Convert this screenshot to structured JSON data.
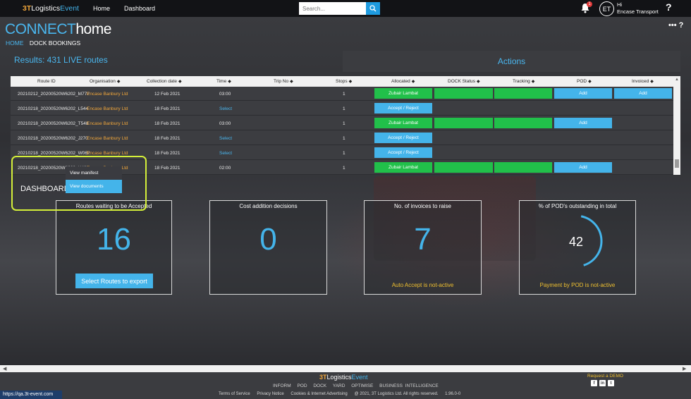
{
  "topbar": {
    "logo": {
      "prefix": "3T",
      "name": "Logistics",
      "suffix": "Event"
    },
    "nav": [
      "Home",
      "Dashboard"
    ],
    "search_placeholder": "Search...",
    "notification_count": "1",
    "avatar_initials": "ET",
    "user_greeting": "Hi",
    "user_name": "Encase Transport",
    "help": "?"
  },
  "page": {
    "brand_connect": "CONNECT",
    "brand_home": "home",
    "breadcrumb_home": "HOME",
    "breadcrumb_current": "DOCK BOOKINGS",
    "corner": "•••",
    "corner_help": "?",
    "results": "Results: 431 LIVE routes",
    "actions": "Actions"
  },
  "table": {
    "columns": [
      "Route ID",
      "Organisation",
      "Collection date",
      "Time",
      "Trip No",
      "Stops",
      "Allocated",
      "DOCK Status",
      "Tracking",
      "POD",
      "Invoiced"
    ],
    "rows": [
      {
        "route": "20210212_20200520W6202_M772",
        "org": "Encase Banbury Ltd",
        "date": "12 Feb 2021",
        "time": "03:00",
        "time_link": false,
        "stops": "1",
        "allocated": "Zubair Lambat",
        "assigned": true,
        "pod": "Add",
        "invoiced": "Add"
      },
      {
        "route": "20210218_20200520W6202_L544",
        "org": "Encase Banbury Ltd",
        "date": "18 Feb 2021",
        "time": "Select",
        "time_link": true,
        "stops": "1",
        "allocated": "Accept / Reject",
        "assigned": false,
        "pod": "",
        "invoiced": ""
      },
      {
        "route": "20210218_20200520W6202_T548",
        "org": "Encase Banbury Ltd",
        "date": "18 Feb 2021",
        "time": "03:00",
        "time_link": false,
        "stops": "1",
        "allocated": "Zubair Lambat",
        "assigned": true,
        "pod": "Add",
        "invoiced": ""
      },
      {
        "route": "20210218_20200520W6202_J270",
        "org": "Encase Banbury Ltd",
        "date": "18 Feb 2021",
        "time": "Select",
        "time_link": true,
        "stops": "1",
        "allocated": "Accept / Reject",
        "assigned": false,
        "pod": "",
        "invoiced": ""
      },
      {
        "route": "20210218_20200520W6202_W062",
        "org": "Encase Banbury Ltd",
        "date": "18 Feb 2021",
        "time": "Select",
        "time_link": true,
        "stops": "1",
        "allocated": "Accept / Reject",
        "assigned": false,
        "pod": "",
        "invoiced": ""
      },
      {
        "route": "20210218_20200520W6202_H485",
        "org": "Encase Banbury Ltd",
        "date": "18 Feb 2021",
        "time": "02:00",
        "time_link": false,
        "stops": "1",
        "allocated": "Zubair Lambat",
        "assigned": true,
        "pod": "Add",
        "invoiced": ""
      }
    ]
  },
  "context_menu": {
    "items": [
      "View manifest",
      "View documents"
    ],
    "active_index": 1
  },
  "dashboard": {
    "label": "DASHBOARD",
    "cards": [
      {
        "title": "Routes waiting to be Accepted",
        "value": "16",
        "button": "Select Routes to export"
      },
      {
        "title": "Cost addition decisions",
        "value": "0"
      },
      {
        "title": "No. of invoices to raise",
        "value": "7",
        "note": "Auto Accept is not-active"
      },
      {
        "title": "% of POD's outstanding in total",
        "value": "42",
        "note": "Payment by POD is not-active",
        "gauge_percent": 42
      }
    ]
  },
  "footer": {
    "logo": {
      "prefix": "3T",
      "name": "Logistics",
      "suffix": "Event"
    },
    "links": [
      "INFORM",
      "POD",
      "DOCK",
      "YARD",
      "OPTIMISE",
      "BUSINESS INTELLIGENCE"
    ],
    "bottom": [
      "Terms of Service",
      "Privacy Notice",
      "Cookies & Internet Advertising",
      "@ 2021, 3T Logistics Ltd. All rights reserved.",
      "1.96.0-0"
    ],
    "demo": "Request a DEMO",
    "social": [
      "f",
      "in",
      "t"
    ]
  },
  "status_url": "https://qa.3t-event.com",
  "colors": {
    "accent": "#44b4ea",
    "green": "#21c04a",
    "orange": "#f0a63b",
    "highlight": "#d4ef3a"
  }
}
